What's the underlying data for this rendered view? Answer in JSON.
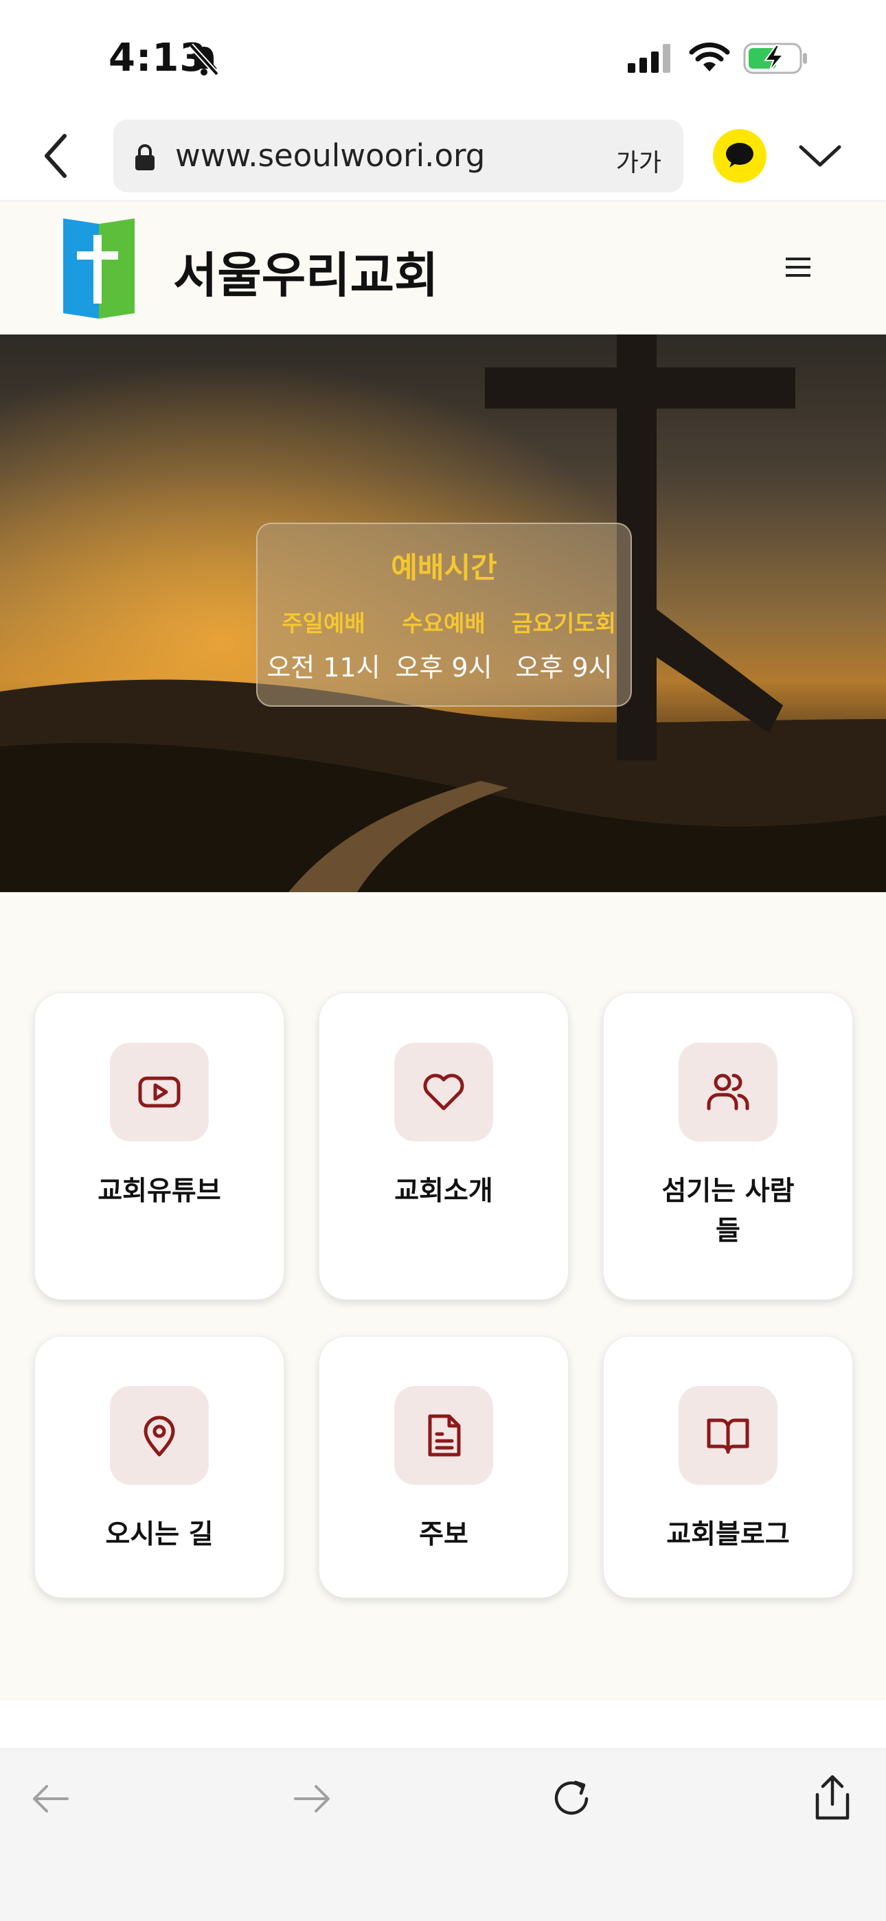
{
  "status": {
    "time": "4:13"
  },
  "browser": {
    "url": "www.seoulwoori.org",
    "text_size": "가가"
  },
  "header": {
    "title": "서울우리교회"
  },
  "hero": {
    "card_title": "예배시간",
    "services": [
      {
        "name": "주일예배",
        "time": "오전 11시"
      },
      {
        "name": "수요예배",
        "time": "오후 9시"
      },
      {
        "name": "금요기도회",
        "time": "오후 9시"
      }
    ]
  },
  "cards": [
    {
      "label": "교회유튜브",
      "icon": "youtube-icon"
    },
    {
      "label": "교회소개",
      "icon": "heart-icon"
    },
    {
      "label": "섬기는 사람들",
      "line1": "섬기는 사람",
      "line2": "들",
      "icon": "people-icon"
    },
    {
      "label": "오시는 길",
      "icon": "location-pin-icon"
    },
    {
      "label": "주보",
      "icon": "document-icon"
    },
    {
      "label": "교회블로그",
      "icon": "book-icon"
    }
  ],
  "colors": {
    "accent": "#8b1a1a",
    "icon_bg": "#f3e7e6",
    "hero_gold": "#f5c731"
  }
}
